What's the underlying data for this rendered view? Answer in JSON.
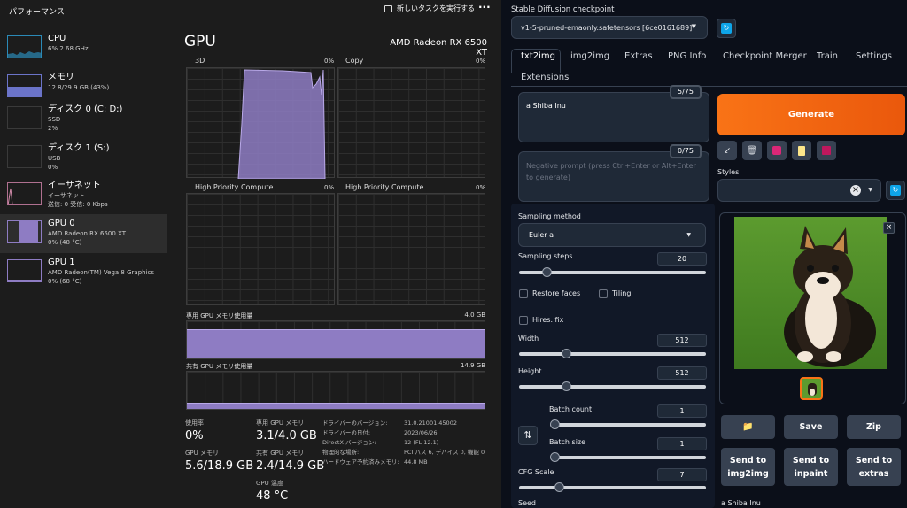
{
  "taskmanager": {
    "title": "パフォーマンス",
    "run_task_label": "新しいタスクを実行する",
    "more_label": "···",
    "sidebar": [
      {
        "name": "CPU",
        "l1": "6% 2.68 GHz",
        "l2": "",
        "l3": ""
      },
      {
        "name": "メモリ",
        "l1": "12.8/29.9 GB (43%)",
        "l2": "",
        "l3": ""
      },
      {
        "name": "ディスク 0 (C: D:)",
        "l1": "SSD",
        "l2": "2%",
        "l3": ""
      },
      {
        "name": "ディスク 1 (S:)",
        "l1": "USB",
        "l2": "0%",
        "l3": ""
      },
      {
        "name": "イーサネット",
        "l1": "イーサネット",
        "l2": "送信: 0 受信: 0 Kbps",
        "l3": ""
      },
      {
        "name": "GPU 0",
        "l1": "AMD Radeon RX 6500 XT",
        "l2": "0% (48 °C)",
        "l3": ""
      },
      {
        "name": "GPU 1",
        "l1": "AMD Radeon(TM) Vega 8 Graphics",
        "l2": "0% (68 °C)",
        "l3": ""
      }
    ],
    "gpu_title": "GPU",
    "gpu_model": "AMD Radeon RX 6500 XT",
    "engines": [
      {
        "label": "3D",
        "pct": "0%"
      },
      {
        "label": "Copy",
        "pct": "0%"
      },
      {
        "label": "High Priority Compute",
        "pct": "0%"
      },
      {
        "label": "High Priority Compute",
        "pct": "0%"
      }
    ],
    "dedicated_label": "専用 GPU メモリ使用量",
    "dedicated_max": "4.0 GB",
    "shared_label": "共有 GPU メモリ使用量",
    "shared_max": "14.9 GB",
    "dedicated_fill": 0.78,
    "shared_fill": 0.16,
    "stats": {
      "util_label": "使用率",
      "util_val": "0%",
      "gpumem_label": "GPU メモリ",
      "gpumem_val": "5.6/18.9 GB",
      "ded_label": "専用 GPU メモリ",
      "ded_val": "3.1/4.0 GB",
      "shr_label": "共有 GPU メモリ",
      "shr_val": "2.4/14.9 GB",
      "temp_label": "GPU 温度",
      "temp_val": "48 °C"
    },
    "info": [
      {
        "k": "ドライバーのバージョン:",
        "v": "31.0.21001.45002"
      },
      {
        "k": "ドライバーの日付:",
        "v": "2023/06/26"
      },
      {
        "k": "DirectX バージョン:",
        "v": "12 (FL 12.1)"
      },
      {
        "k": "物理的な場所:",
        "v": "PCI バス 6, デバイス 0, 機能 0"
      },
      {
        "k": "ハードウェア予約済みメモリ:",
        "v": "44.8 MB"
      }
    ]
  },
  "sd": {
    "checkpoint_label": "Stable Diffusion checkpoint",
    "checkpoint_value": "v1-5-pruned-emaonly.safetensors [6ce0161689]",
    "tabs": [
      "txt2img",
      "img2img",
      "Extras",
      "PNG Info",
      "Checkpoint Merger",
      "Train",
      "Settings",
      "Extensions"
    ],
    "prompt": "a Shiba Inu",
    "prompt_tokens": "5/75",
    "neg_placeholder": "Negative prompt (press Ctrl+Enter or Alt+Enter to generate)",
    "neg_tokens": "0/75",
    "generate": "Generate",
    "styles_label": "Styles",
    "styles_clear": "×",
    "sampling_method_label": "Sampling method",
    "sampling_method": "Euler a",
    "sampling_steps_label": "Sampling steps",
    "sampling_steps": "20",
    "restore_faces": "Restore faces",
    "tiling": "Tiling",
    "hires_fix": "Hires. fix",
    "width_label": "Width",
    "width": "512",
    "height_label": "Height",
    "height": "512",
    "batch_count_label": "Batch count",
    "batch_count": "1",
    "batch_size_label": "Batch size",
    "batch_size": "1",
    "cfg_label": "CFG Scale",
    "cfg": "7",
    "seed_label": "Seed",
    "save": "Save",
    "zip": "Zip",
    "send_img2img": "Send to img2img",
    "send_inpaint": "Send to inpaint",
    "send_extras": "Send to extras",
    "caption": "a Shiba Inu",
    "close": "×",
    "swap_icon": "⇅",
    "folder_icon": "📁",
    "sliders": {
      "steps": 0.13,
      "width": 0.24,
      "height": 0.24,
      "batch_count": 0.0,
      "batch_size": 0.0,
      "cfg": 0.2
    }
  }
}
